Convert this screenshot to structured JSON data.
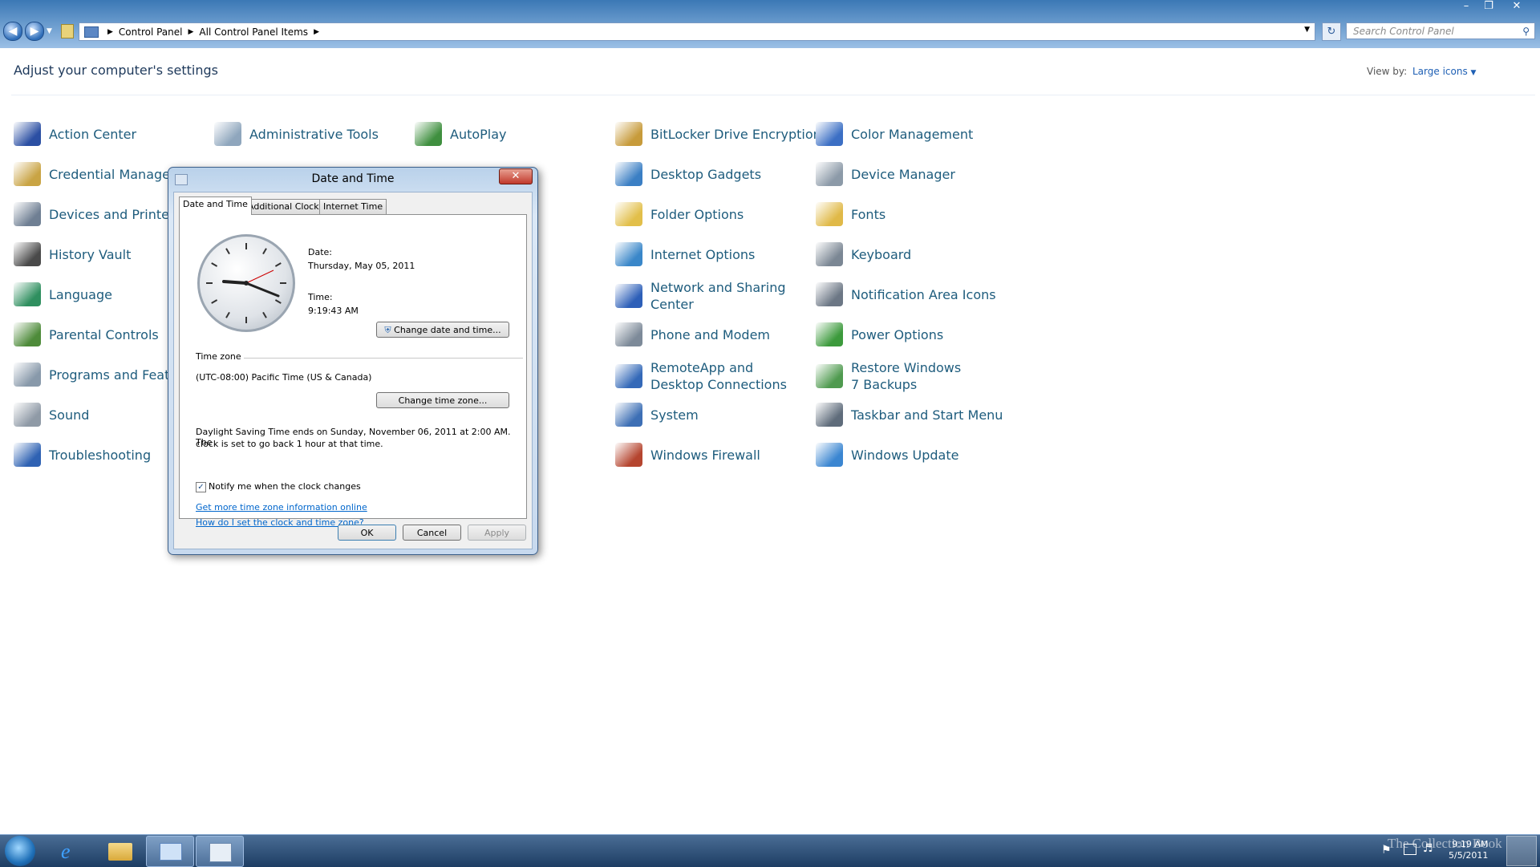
{
  "nav": {
    "breadcrumbs": [
      "Control Panel",
      "All Control Panel Items"
    ],
    "search_placeholder": "Search Control Panel"
  },
  "header": {
    "title": "Adjust your computer's settings",
    "view_by_label": "View by:",
    "view_by_value": "Large icons"
  },
  "items": [
    {
      "label": "Action Center",
      "icon": "action-center-icon",
      "color": "#2b4fa3"
    },
    {
      "label": "Administrative Tools",
      "icon": "administrative-tools-icon",
      "color": "#8fa6bd"
    },
    {
      "label": "AutoPlay",
      "icon": "autoplay-icon",
      "color": "#3f8f3f"
    },
    {
      "label": "BitLocker Drive Encryption",
      "icon": "bitlocker-icon",
      "color": "#c79b3b"
    },
    {
      "label": "Color Management",
      "icon": "color-management-icon",
      "color": "#3c6fc4"
    },
    {
      "label": "Credential Manager",
      "icon": "credential-manager-icon",
      "color": "#c9a444"
    },
    {
      "label": "Desktop Gadgets",
      "icon": "desktop-gadgets-icon",
      "color": "#3b7fc4"
    },
    {
      "label": "Device Manager",
      "icon": "device-manager-icon",
      "color": "#8c9aa8"
    },
    {
      "label": "Devices and Printers",
      "icon": "devices-printers-icon",
      "color": "#6f7f93"
    },
    {
      "label": "Folder Options",
      "icon": "folder-options-icon",
      "color": "#e2bf4a"
    },
    {
      "label": "Fonts",
      "icon": "fonts-icon",
      "color": "#e0b948"
    },
    {
      "label": "History Vault",
      "icon": "history-vault-icon",
      "color": "#4a4a4a"
    },
    {
      "label": "Internet Options",
      "icon": "internet-options-icon",
      "color": "#3a87c9"
    },
    {
      "label": "Keyboard",
      "icon": "keyboard-icon",
      "color": "#7b8794"
    },
    {
      "label": "Language",
      "icon": "language-icon",
      "color": "#2f8f5f"
    },
    {
      "label": "Network and Sharing Center",
      "icon": "network-sharing-icon",
      "color": "#2d5fb8"
    },
    {
      "label": "Notification Area Icons",
      "icon": "notification-area-icon",
      "color": "#6c7785"
    },
    {
      "label": "Parental Controls",
      "icon": "parental-controls-icon",
      "color": "#4e8b3a"
    },
    {
      "label": "Phone and Modem",
      "icon": "phone-modem-icon",
      "color": "#7d8a99"
    },
    {
      "label": "Power Options",
      "icon": "power-options-icon",
      "color": "#3c9a3c"
    },
    {
      "label": "Programs and Features",
      "icon": "programs-features-icon",
      "color": "#8899aa"
    },
    {
      "label": "RemoteApp and Desktop Connections",
      "icon": "remoteapp-icon",
      "color": "#3469b8"
    },
    {
      "label": "Restore Windows 7 Backups",
      "icon": "restore-backups-icon",
      "color": "#4f9a4f"
    },
    {
      "label": "Sound",
      "icon": "sound-icon",
      "color": "#8f9aa6"
    },
    {
      "label": "System",
      "icon": "system-icon",
      "color": "#3d6fb5"
    },
    {
      "label": "Taskbar and Start Menu",
      "icon": "taskbar-start-icon",
      "color": "#5f6c7b"
    },
    {
      "label": "Troubleshooting",
      "icon": "troubleshooting-icon",
      "color": "#2f62b3"
    },
    {
      "label": "Windows Firewall",
      "icon": "windows-firewall-icon",
      "color": "#b5452f"
    },
    {
      "label": "Windows Update",
      "icon": "windows-update-icon",
      "color": "#3b86d1"
    }
  ],
  "dialog": {
    "title": "Date and Time",
    "tabs": [
      "Date and Time",
      "Additional Clocks",
      "Internet Time"
    ],
    "date_label": "Date:",
    "date_value": "Thursday, May 05, 2011",
    "time_label": "Time:",
    "time_value": "9:19:43 AM",
    "change_datetime_button": "Change date and time...",
    "timezone_heading": "Time zone",
    "timezone_value": "(UTC-08:00) Pacific Time (US & Canada)",
    "change_timezone_button": "Change time zone...",
    "dst_line1": "Daylight Saving Time ends on Sunday, November 06, 2011 at 2:00 AM. The",
    "dst_line2": "clock is set to go back 1 hour at that time.",
    "notify_label": "Notify me when the clock changes",
    "notify_checked": true,
    "link_more_info": "Get more time zone information online",
    "link_how_to": "How do I set the clock and time zone?",
    "ok": "OK",
    "cancel": "Cancel",
    "apply": "Apply"
  },
  "taskbar": {
    "clock_time": "9:19 AM",
    "clock_date": "5/5/2011",
    "watermark": "The Collection Book",
    "buttons": [
      "internet-explorer-icon",
      "windows-explorer-icon",
      "control-panel-icon",
      "date-time-icon"
    ]
  }
}
